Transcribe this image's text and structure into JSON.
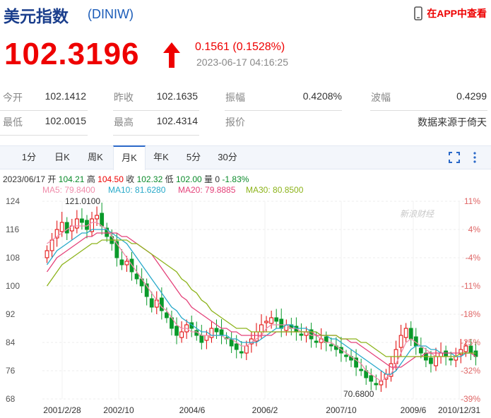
{
  "header": {
    "name": "美元指数",
    "code": "(DINIW)",
    "app_label": "在APP中查看"
  },
  "quote": {
    "price": "102.3196",
    "change": "0.1561 (0.1528%)",
    "time": "2023-06-17 04:16:25"
  },
  "stats": {
    "row1": [
      {
        "label": "今开",
        "value": "102.1412"
      },
      {
        "label": "昨收",
        "value": "102.1635"
      },
      {
        "label": "振幅",
        "value": "0.4208%"
      },
      {
        "label": "波幅",
        "value": "0.4299"
      }
    ],
    "row2": [
      {
        "label": "最低",
        "value": "102.0015"
      },
      {
        "label": "最高",
        "value": "102.4314"
      },
      {
        "label": "报价",
        "value": ""
      },
      {
        "label": "",
        "value": "数据来源于倚天"
      }
    ]
  },
  "tabs": [
    "1分",
    "日K",
    "周K",
    "月K",
    "年K",
    "5分",
    "30分"
  ],
  "active_tab": "月K",
  "toolbar": {
    "icons": [
      "fullscreen-icon",
      "more-icon"
    ]
  },
  "bar_info": {
    "date": "2023/06/17",
    "open_label": "开",
    "open": "104.21",
    "high_label": "高",
    "high": "104.50",
    "close_label": "收",
    "close": "102.32",
    "low_label": "低",
    "low": "102.00",
    "vol_label": "量",
    "vol": "0",
    "pct": "-1.83%"
  },
  "ma": [
    {
      "label": "MA5: 79.8400",
      "color": "#f08caa"
    },
    {
      "label": "MA10: 81.6280",
      "color": "#27a9c9"
    },
    {
      "label": "MA20: 79.8885",
      "color": "#e4427a"
    },
    {
      "label": "MA30: 80.8500",
      "color": "#8cb31a"
    }
  ],
  "colors": {
    "up": "#e00000",
    "down": "#0a9a2a",
    "accent": "#2a68c8"
  },
  "chart_data": {
    "type": "candlestick",
    "y_ticks": [
      "124",
      "116",
      "108",
      "100",
      "92",
      "84",
      "76",
      "68"
    ],
    "pct_ticks": [
      "11%",
      "4%",
      "-4%",
      "-11%",
      "-18%",
      "-25%",
      "-32%",
      "-39%"
    ],
    "x_ticks": [
      "2001/2/28",
      "2002/10",
      "2004/6",
      "2006/2",
      "2007/10",
      "2009/6",
      "2010/12/31"
    ],
    "ylim": [
      68,
      124
    ],
    "annotations": [
      "121.0100",
      "70.6800"
    ],
    "watermark": "新浪财经",
    "close_series": [
      110,
      113,
      116,
      118,
      115,
      117,
      119,
      118,
      116,
      119,
      120,
      117,
      114,
      112,
      108,
      106,
      107,
      104,
      102,
      100,
      97,
      94,
      96,
      93,
      91,
      88,
      86,
      87,
      89,
      88,
      86,
      84,
      86,
      88,
      87,
      86,
      85,
      83,
      82,
      81,
      83,
      85,
      87,
      89,
      90,
      91,
      90,
      88,
      89,
      88,
      87,
      86,
      87,
      85,
      84,
      85,
      84,
      83,
      82,
      81,
      80,
      79,
      77,
      76,
      74,
      73,
      72,
      73,
      75,
      78,
      82,
      86,
      88,
      85,
      83,
      81,
      79,
      78,
      80,
      81,
      80,
      79,
      80,
      82,
      83,
      81,
      80
    ],
    "ma5": [
      112,
      113,
      114,
      115,
      116,
      117,
      117,
      117,
      117,
      118,
      118,
      117,
      116,
      114,
      112,
      110,
      108,
      106,
      104,
      102,
      100,
      98,
      96,
      94,
      93,
      91,
      89,
      88,
      88,
      87,
      87,
      86,
      86,
      86,
      86,
      86,
      85,
      85,
      84,
      83,
      83,
      84,
      85,
      86,
      88,
      89,
      89,
      89,
      89,
      88,
      88,
      87,
      87,
      86,
      86,
      85,
      84,
      84,
      83,
      82,
      81,
      80,
      79,
      78,
      76,
      75,
      74,
      73,
      74,
      75,
      78,
      81,
      84,
      85,
      84,
      83,
      82,
      81,
      80,
      80,
      80,
      80,
      80,
      80,
      81,
      81,
      80
    ],
    "ma10": [
      106,
      108,
      110,
      111,
      112,
      113,
      114,
      115,
      115,
      116,
      116,
      116,
      116,
      115,
      114,
      113,
      112,
      110,
      108,
      106,
      104,
      102,
      100,
      98,
      96,
      94,
      93,
      91,
      90,
      89,
      88,
      87,
      87,
      86,
      86,
      86,
      86,
      85,
      85,
      84,
      84,
      84,
      84,
      85,
      86,
      87,
      88,
      88,
      89,
      89,
      88,
      88,
      88,
      87,
      87,
      86,
      86,
      85,
      85,
      84,
      83,
      82,
      81,
      80,
      79,
      78,
      77,
      76,
      75,
      75,
      76,
      78,
      80,
      82,
      83,
      83,
      83,
      82,
      82,
      81,
      81,
      81,
      80,
      80,
      81,
      81,
      81
    ],
    "ma20": [
      104,
      106,
      108,
      109,
      110,
      111,
      112,
      113,
      114,
      114,
      115,
      115,
      115,
      115,
      115,
      114,
      114,
      113,
      112,
      111,
      110,
      109,
      107,
      105,
      103,
      101,
      99,
      97,
      96,
      94,
      93,
      92,
      91,
      90,
      89,
      88,
      88,
      87,
      87,
      86,
      86,
      86,
      86,
      86,
      86,
      86,
      87,
      87,
      87,
      87,
      87,
      87,
      87,
      87,
      86,
      86,
      86,
      86,
      86,
      85,
      85,
      84,
      84,
      83,
      82,
      81,
      80,
      79,
      78,
      77,
      77,
      77,
      78,
      79,
      80,
      80,
      81,
      81,
      81,
      81,
      81,
      81,
      81,
      81,
      81,
      81,
      80
    ],
    "ma30": [
      100,
      102,
      104,
      106,
      107,
      108,
      109,
      110,
      111,
      112,
      112,
      113,
      113,
      113,
      113,
      113,
      113,
      112,
      112,
      111,
      110,
      109,
      108,
      107,
      106,
      105,
      104,
      102,
      101,
      99,
      98,
      96,
      95,
      93,
      92,
      91,
      90,
      89,
      88,
      88,
      88,
      87,
      87,
      87,
      87,
      87,
      87,
      87,
      87,
      87,
      87,
      87,
      87,
      87,
      87,
      86,
      86,
      86,
      86,
      85,
      85,
      85,
      85,
      84,
      84,
      83,
      82,
      81,
      80,
      80,
      80,
      80,
      80,
      80,
      80,
      80,
      80,
      80,
      80,
      80,
      80,
      80,
      80,
      81,
      81,
      81,
      81
    ]
  }
}
